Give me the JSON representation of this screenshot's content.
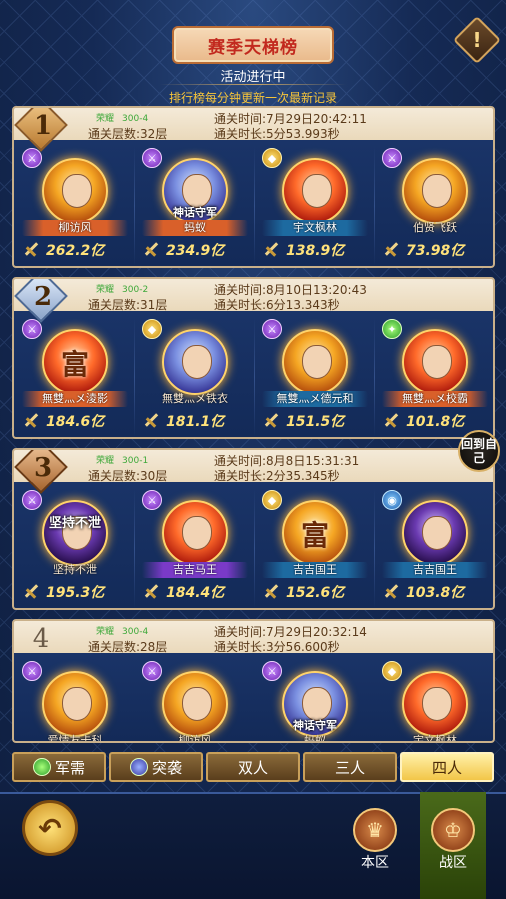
{
  "header": {
    "title": "赛季天梯榜",
    "info_icon": "!",
    "status": "活动进行中",
    "notice": "排行榜每分钟更新一次最新记录"
  },
  "entries": [
    {
      "rank": "1",
      "honor_label": "荣耀",
      "honor_value": "300-4",
      "floors": "通关层数:32层",
      "pass_time": "通关时间:7月29日20:42:11",
      "duration": "通关时长:5分53.993秒",
      "heroes": [
        {
          "name": "柳访风",
          "power": "262.2亿",
          "title": ""
        },
        {
          "name": "蚂蚁",
          "power": "234.9亿",
          "title": "神话守军"
        },
        {
          "name": "宇文枫林",
          "power": "138.9亿",
          "title": ""
        },
        {
          "name": "伯贤飞跃",
          "power": "73.98亿",
          "title": ""
        }
      ]
    },
    {
      "rank": "2",
      "honor_label": "荣耀",
      "honor_value": "300-2",
      "floors": "通关层数:31层",
      "pass_time": "通关时间:8月10日13:20:43",
      "duration": "通关时长:6分13.343秒",
      "heroes": [
        {
          "name": "無雙灬メ淩影",
          "power": "184.6亿",
          "title": ""
        },
        {
          "name": "無雙灬メ铁衣",
          "power": "181.1亿",
          "title": ""
        },
        {
          "name": "無雙灬メ德元和",
          "power": "151.5亿",
          "title": ""
        },
        {
          "name": "無雙灬メ校霸",
          "power": "101.8亿",
          "title": ""
        }
      ]
    },
    {
      "rank": "3",
      "honor_label": "荣耀",
      "honor_value": "300-1",
      "floors": "通关层数:30层",
      "pass_time": "通关时间:8月8日15:31:31",
      "duration": "通关时长:2分35.345秒",
      "heroes": [
        {
          "name": "坚持不泄",
          "power": "195.3亿",
          "title": "坚持不泄"
        },
        {
          "name": "吉吉马王",
          "power": "184.4亿",
          "title": ""
        },
        {
          "name": "吉吉国王",
          "power": "152.6亿",
          "title": ""
        },
        {
          "name": "吉吉国王",
          "power": "103.8亿",
          "title": ""
        }
      ]
    },
    {
      "rank": "4",
      "honor_label": "荣耀",
      "honor_value": "300-4",
      "floors": "通关层数:28层",
      "pass_time": "通关时间:7月29日20:32:14",
      "duration": "通关时长:3分56.600秒",
      "heroes": [
        {
          "name": "爱情友卡科",
          "power": "",
          "title": ""
        },
        {
          "name": "柳访风",
          "power": "",
          "title": ""
        },
        {
          "name": "蚂蚁",
          "power": "",
          "title": "神话守军"
        },
        {
          "name": "宇文枫林",
          "power": "",
          "title": ""
        }
      ]
    }
  ],
  "back_to_self": "回到自己",
  "tabs": [
    "军需",
    "突袭",
    "双人",
    "三人",
    "四人"
  ],
  "active_tab": "四人",
  "footer": {
    "local_zone": "本区",
    "war_zone": "战区"
  }
}
